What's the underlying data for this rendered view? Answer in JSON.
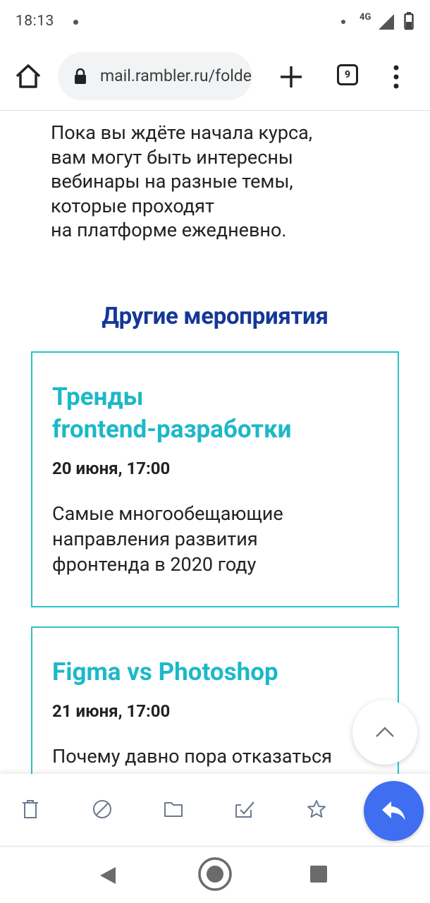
{
  "status_bar": {
    "time": "18:13",
    "network": "4G"
  },
  "browser": {
    "url": "mail.rambler.ru/folder",
    "tab_count": "9",
    "icons": [
      "home-icon",
      "lock-icon",
      "plus-icon",
      "tabs-icon",
      "more-vert-icon"
    ]
  },
  "email": {
    "intro_lines": [
      "Пока вы ждёте начала курса,",
      "вам могут быть интересны",
      "вебинары на разные темы,",
      "которые проходят",
      "на платформе ежедневно."
    ],
    "section_title": "Другие мероприятия",
    "events": [
      {
        "title_lines": [
          "Тренды",
          "frontend-разработки"
        ],
        "date": "20 июня, 17:00",
        "description_lines": [
          "Самые многообещающие",
          "направления развития",
          "фронтенда в 2020 году"
        ]
      },
      {
        "title_lines": [
          "Figma vs Photoshop"
        ],
        "date": "21 июня, 17:00",
        "description_lines": [
          "Почему давно пора отказаться"
        ]
      }
    ],
    "colors": {
      "section_title": "#153896",
      "card_title": "#1db8c8",
      "card_border": "#29c3c8",
      "reply_button": "#3f6ef0"
    }
  },
  "actions": {
    "icons": [
      "trash-icon",
      "block-icon",
      "folder-icon",
      "mark-checked-icon",
      "star-icon",
      "reply-icon"
    ]
  },
  "nav": {
    "icons": [
      "back-icon",
      "home-circle-icon",
      "recent-apps-icon"
    ]
  }
}
